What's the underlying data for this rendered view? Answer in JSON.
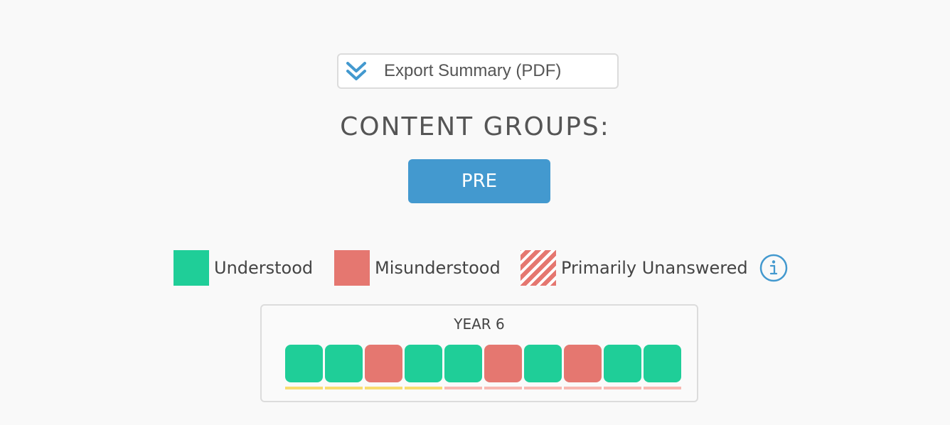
{
  "export": {
    "label": "Export Summary (PDF)",
    "icon": "double-chevron-down-icon",
    "icon_color": "#4399cf"
  },
  "heading": "CONTENT GROUPS:",
  "group_button": {
    "label": "PRE",
    "color": "#4399cf"
  },
  "legend": {
    "understood": {
      "label": "Understood",
      "color": "#1fce98"
    },
    "misunderstood": {
      "label": "Misunderstood",
      "color": "#e57770"
    },
    "unanswered": {
      "label": "Primarily Unanswered",
      "color": "#e57770",
      "pattern": "diagonal-stripes"
    },
    "info_icon": "info-icon"
  },
  "year_panel": {
    "title": "YEAR 6",
    "tiles": [
      {
        "status": "understood",
        "underline": "yellow"
      },
      {
        "status": "understood",
        "underline": "yellow"
      },
      {
        "status": "misunderstood",
        "underline": "yellow"
      },
      {
        "status": "understood",
        "underline": "yellow"
      },
      {
        "status": "understood",
        "underline": "pink"
      },
      {
        "status": "misunderstood",
        "underline": "pink"
      },
      {
        "status": "understood",
        "underline": "pink"
      },
      {
        "status": "misunderstood",
        "underline": "pink"
      },
      {
        "status": "understood",
        "underline": "pink"
      },
      {
        "status": "understood",
        "underline": "pink"
      }
    ],
    "underline_colors": {
      "yellow": "#f8dc6f",
      "pink": "#f8b8b2"
    }
  }
}
